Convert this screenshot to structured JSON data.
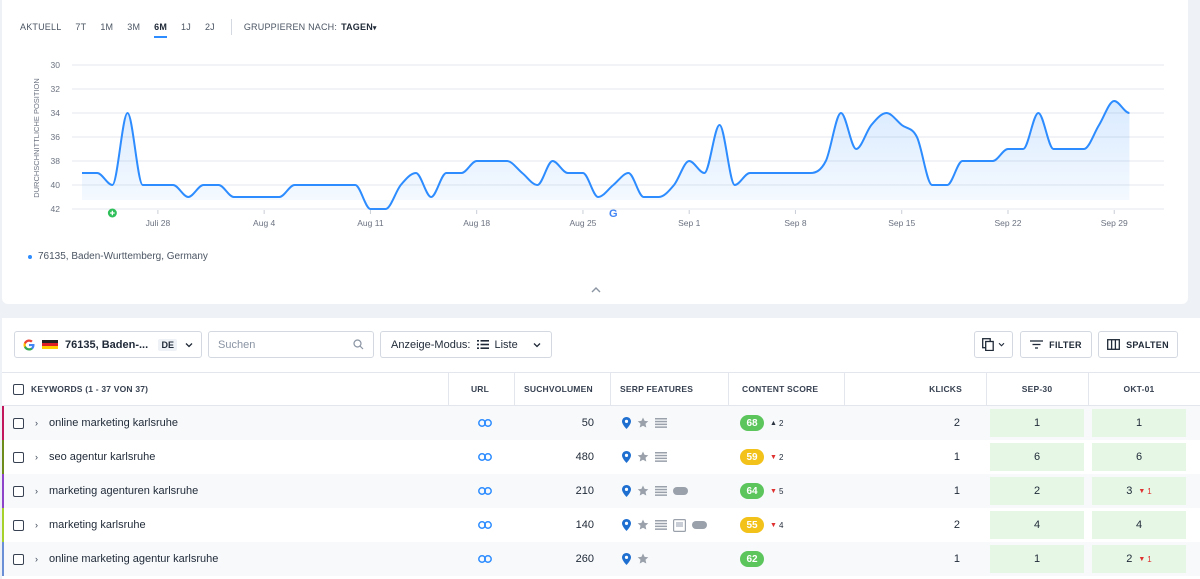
{
  "range": {
    "tabs": [
      {
        "label": "AKTUELL",
        "active": false
      },
      {
        "label": "7T",
        "active": false
      },
      {
        "label": "1M",
        "active": false
      },
      {
        "label": "3M",
        "active": false
      },
      {
        "label": "6M",
        "active": true
      },
      {
        "label": "1J",
        "active": false
      },
      {
        "label": "2J",
        "active": false
      }
    ],
    "group_label": "GRUPPIEREN NACH:",
    "group_value": "TAGEN"
  },
  "chart_data": {
    "type": "line",
    "title": "",
    "ylabel": "DURCHSCHNITTLICHE POSITION",
    "y_inverted": true,
    "ylim": [
      30,
      42
    ],
    "yticks": [
      "30",
      "32",
      "34",
      "36",
      "38",
      "40",
      "42"
    ],
    "xticks": [
      "Juli 28",
      "Aug 4",
      "Aug 11",
      "Aug 18",
      "Aug 25",
      "Sep 1",
      "Sep 8",
      "Sep 15",
      "Sep 22",
      "Sep 29"
    ],
    "x_start": "Jul 23",
    "series": [
      {
        "name": "76135, Baden-Wurttemberg, Germany",
        "color": "#2d8cff",
        "x": [
          "Jul 23",
          "Jul 24",
          "Jul 25",
          "Jul 26",
          "Jul 27",
          "Jul 28",
          "Jul 29",
          "Jul 30",
          "Jul 31",
          "Aug 1",
          "Aug 2",
          "Aug 3",
          "Aug 4",
          "Aug 5",
          "Aug 6",
          "Aug 7",
          "Aug 8",
          "Aug 9",
          "Aug 10",
          "Aug 11",
          "Aug 12",
          "Aug 13",
          "Aug 14",
          "Aug 15",
          "Aug 16",
          "Aug 17",
          "Aug 18",
          "Aug 19",
          "Aug 20",
          "Aug 21",
          "Aug 22",
          "Aug 23",
          "Aug 24",
          "Aug 25",
          "Aug 26",
          "Aug 27",
          "Aug 28",
          "Aug 29",
          "Aug 30",
          "Aug 31",
          "Sep 1",
          "Sep 2",
          "Sep 3",
          "Sep 4",
          "Sep 5",
          "Sep 6",
          "Sep 7",
          "Sep 8",
          "Sep 9",
          "Sep 10",
          "Sep 11",
          "Sep 12",
          "Sep 13",
          "Sep 14",
          "Sep 15",
          "Sep 16",
          "Sep 17",
          "Sep 18",
          "Sep 19",
          "Sep 20",
          "Sep 21",
          "Sep 22",
          "Sep 23",
          "Sep 24",
          "Sep 25",
          "Sep 26",
          "Sep 27",
          "Sep 28",
          "Sep 29",
          "Sep 30"
        ],
        "values": [
          39,
          39,
          40,
          34,
          40,
          40,
          40,
          41,
          40,
          40,
          41,
          41,
          41,
          41,
          40,
          40,
          40,
          40,
          40,
          42,
          42,
          40,
          39,
          41,
          39,
          39,
          38,
          38,
          38,
          39,
          40,
          38,
          39,
          39,
          41,
          40,
          39,
          41,
          41,
          40,
          38,
          39,
          35,
          40,
          39,
          39,
          39,
          39,
          39,
          38,
          34,
          37,
          35,
          34,
          35,
          36,
          40,
          40,
          38,
          38,
          38,
          37,
          37,
          34,
          37,
          37,
          37,
          35,
          33,
          34
        ]
      }
    ],
    "markers": [
      {
        "x": "Jul 25",
        "icon": "add-note-icon"
      },
      {
        "x": "Aug 27",
        "icon": "google-update-icon"
      }
    ],
    "grid": true,
    "legend": "bottom-left"
  },
  "legend": {
    "location": "76135, Baden-Wurttemberg, Germany"
  },
  "toolbar": {
    "location_label": "76135, Baden-...",
    "language": "DE",
    "search_placeholder": "Suchen",
    "mode_label": "Anzeige-Modus:",
    "mode_value": "Liste",
    "filter_label": "FILTER",
    "columns_label": "SPALTEN"
  },
  "table": {
    "headers": {
      "keywords": "KEYWORDS (1 - 37 VON 37)",
      "url": "URL",
      "volume": "SUCHVOLUMEN",
      "serp": "SERP FEATURES",
      "content": "CONTENT SCORE",
      "clicks": "KLICKS",
      "d1": "SEP-30",
      "d2": "OKT-01"
    },
    "rows": [
      {
        "keyword": "online marketing karlsruhe",
        "accent": "#c2185b",
        "volume": "50",
        "features": [
          "map-pin-icon",
          "star-icon",
          "list-icon"
        ],
        "score": "68",
        "score_color": "#5cc55c",
        "delta": "2",
        "delta_dir": "up",
        "clicks": "2",
        "d1": "1",
        "d2": "1",
        "d2_delta": ""
      },
      {
        "keyword": "seo agentur karlsruhe",
        "accent": "#6d8b1a",
        "volume": "480",
        "features": [
          "map-pin-icon",
          "star-icon",
          "list-icon"
        ],
        "score": "59",
        "score_color": "#f2c21b",
        "delta": "2",
        "delta_dir": "down",
        "clicks": "1",
        "d1": "6",
        "d2": "6",
        "d2_delta": ""
      },
      {
        "keyword": "marketing agenturen karlsruhe",
        "accent": "#8e44c9",
        "volume": "210",
        "features": [
          "map-pin-icon",
          "star-icon",
          "list-icon",
          "pill-icon"
        ],
        "score": "64",
        "score_color": "#5cc55c",
        "delta": "5",
        "delta_dir": "down",
        "clicks": "1",
        "d1": "2",
        "d2": "3",
        "d2_delta": "1"
      },
      {
        "keyword": "marketing karlsruhe",
        "accent": "#a6d12c",
        "volume": "140",
        "features": [
          "map-pin-icon",
          "star-icon",
          "list-icon",
          "image-icon",
          "pill-icon"
        ],
        "score": "55",
        "score_color": "#f2c21b",
        "delta": "4",
        "delta_dir": "down",
        "clicks": "2",
        "d1": "4",
        "d2": "4",
        "d2_delta": ""
      },
      {
        "keyword": "online marketing agentur karlsruhe",
        "accent": "#6b8fd6",
        "volume": "260",
        "features": [
          "map-pin-icon",
          "star-icon"
        ],
        "score": "62",
        "score_color": "#5cc55c",
        "delta": "",
        "delta_dir": "",
        "clicks": "1",
        "d1": "1",
        "d2": "2",
        "d2_delta": "1"
      }
    ]
  }
}
